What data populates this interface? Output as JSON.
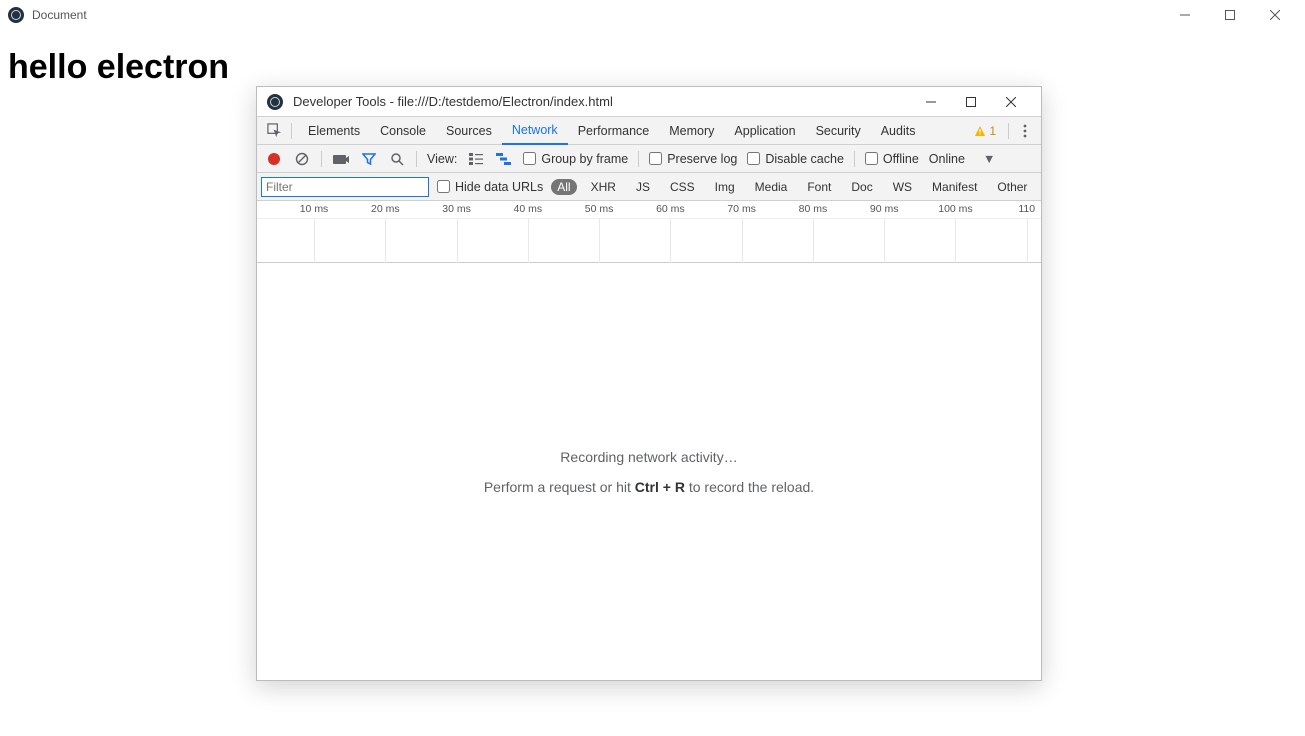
{
  "mainWindow": {
    "title": "Document"
  },
  "page": {
    "heading": "hello electron"
  },
  "devtools": {
    "title": "Developer Tools - file:///D:/testdemo/Electron/index.html",
    "tabs": [
      "Elements",
      "Console",
      "Sources",
      "Network",
      "Performance",
      "Memory",
      "Application",
      "Security",
      "Audits"
    ],
    "activeTab": "Network",
    "warnings": "1",
    "toolbar": {
      "viewLabel": "View:",
      "groupByFrame": "Group by frame",
      "preserveLog": "Preserve log",
      "disableCache": "Disable cache",
      "offline": "Offline",
      "throttling": "Online"
    },
    "filter": {
      "placeholder": "Filter",
      "hideDataUrls": "Hide data URLs",
      "types": [
        "All",
        "XHR",
        "JS",
        "CSS",
        "Img",
        "Media",
        "Font",
        "Doc",
        "WS",
        "Manifest",
        "Other"
      ],
      "activeType": "All"
    },
    "timeline": {
      "ticks": [
        "10 ms",
        "20 ms",
        "30 ms",
        "40 ms",
        "50 ms",
        "60 ms",
        "70 ms",
        "80 ms",
        "90 ms",
        "100 ms",
        "110"
      ]
    },
    "empty": {
      "line1": "Recording network activity…",
      "line2a": "Perform a request or hit ",
      "kbd": "Ctrl + R",
      "line2b": " to record the reload."
    }
  }
}
